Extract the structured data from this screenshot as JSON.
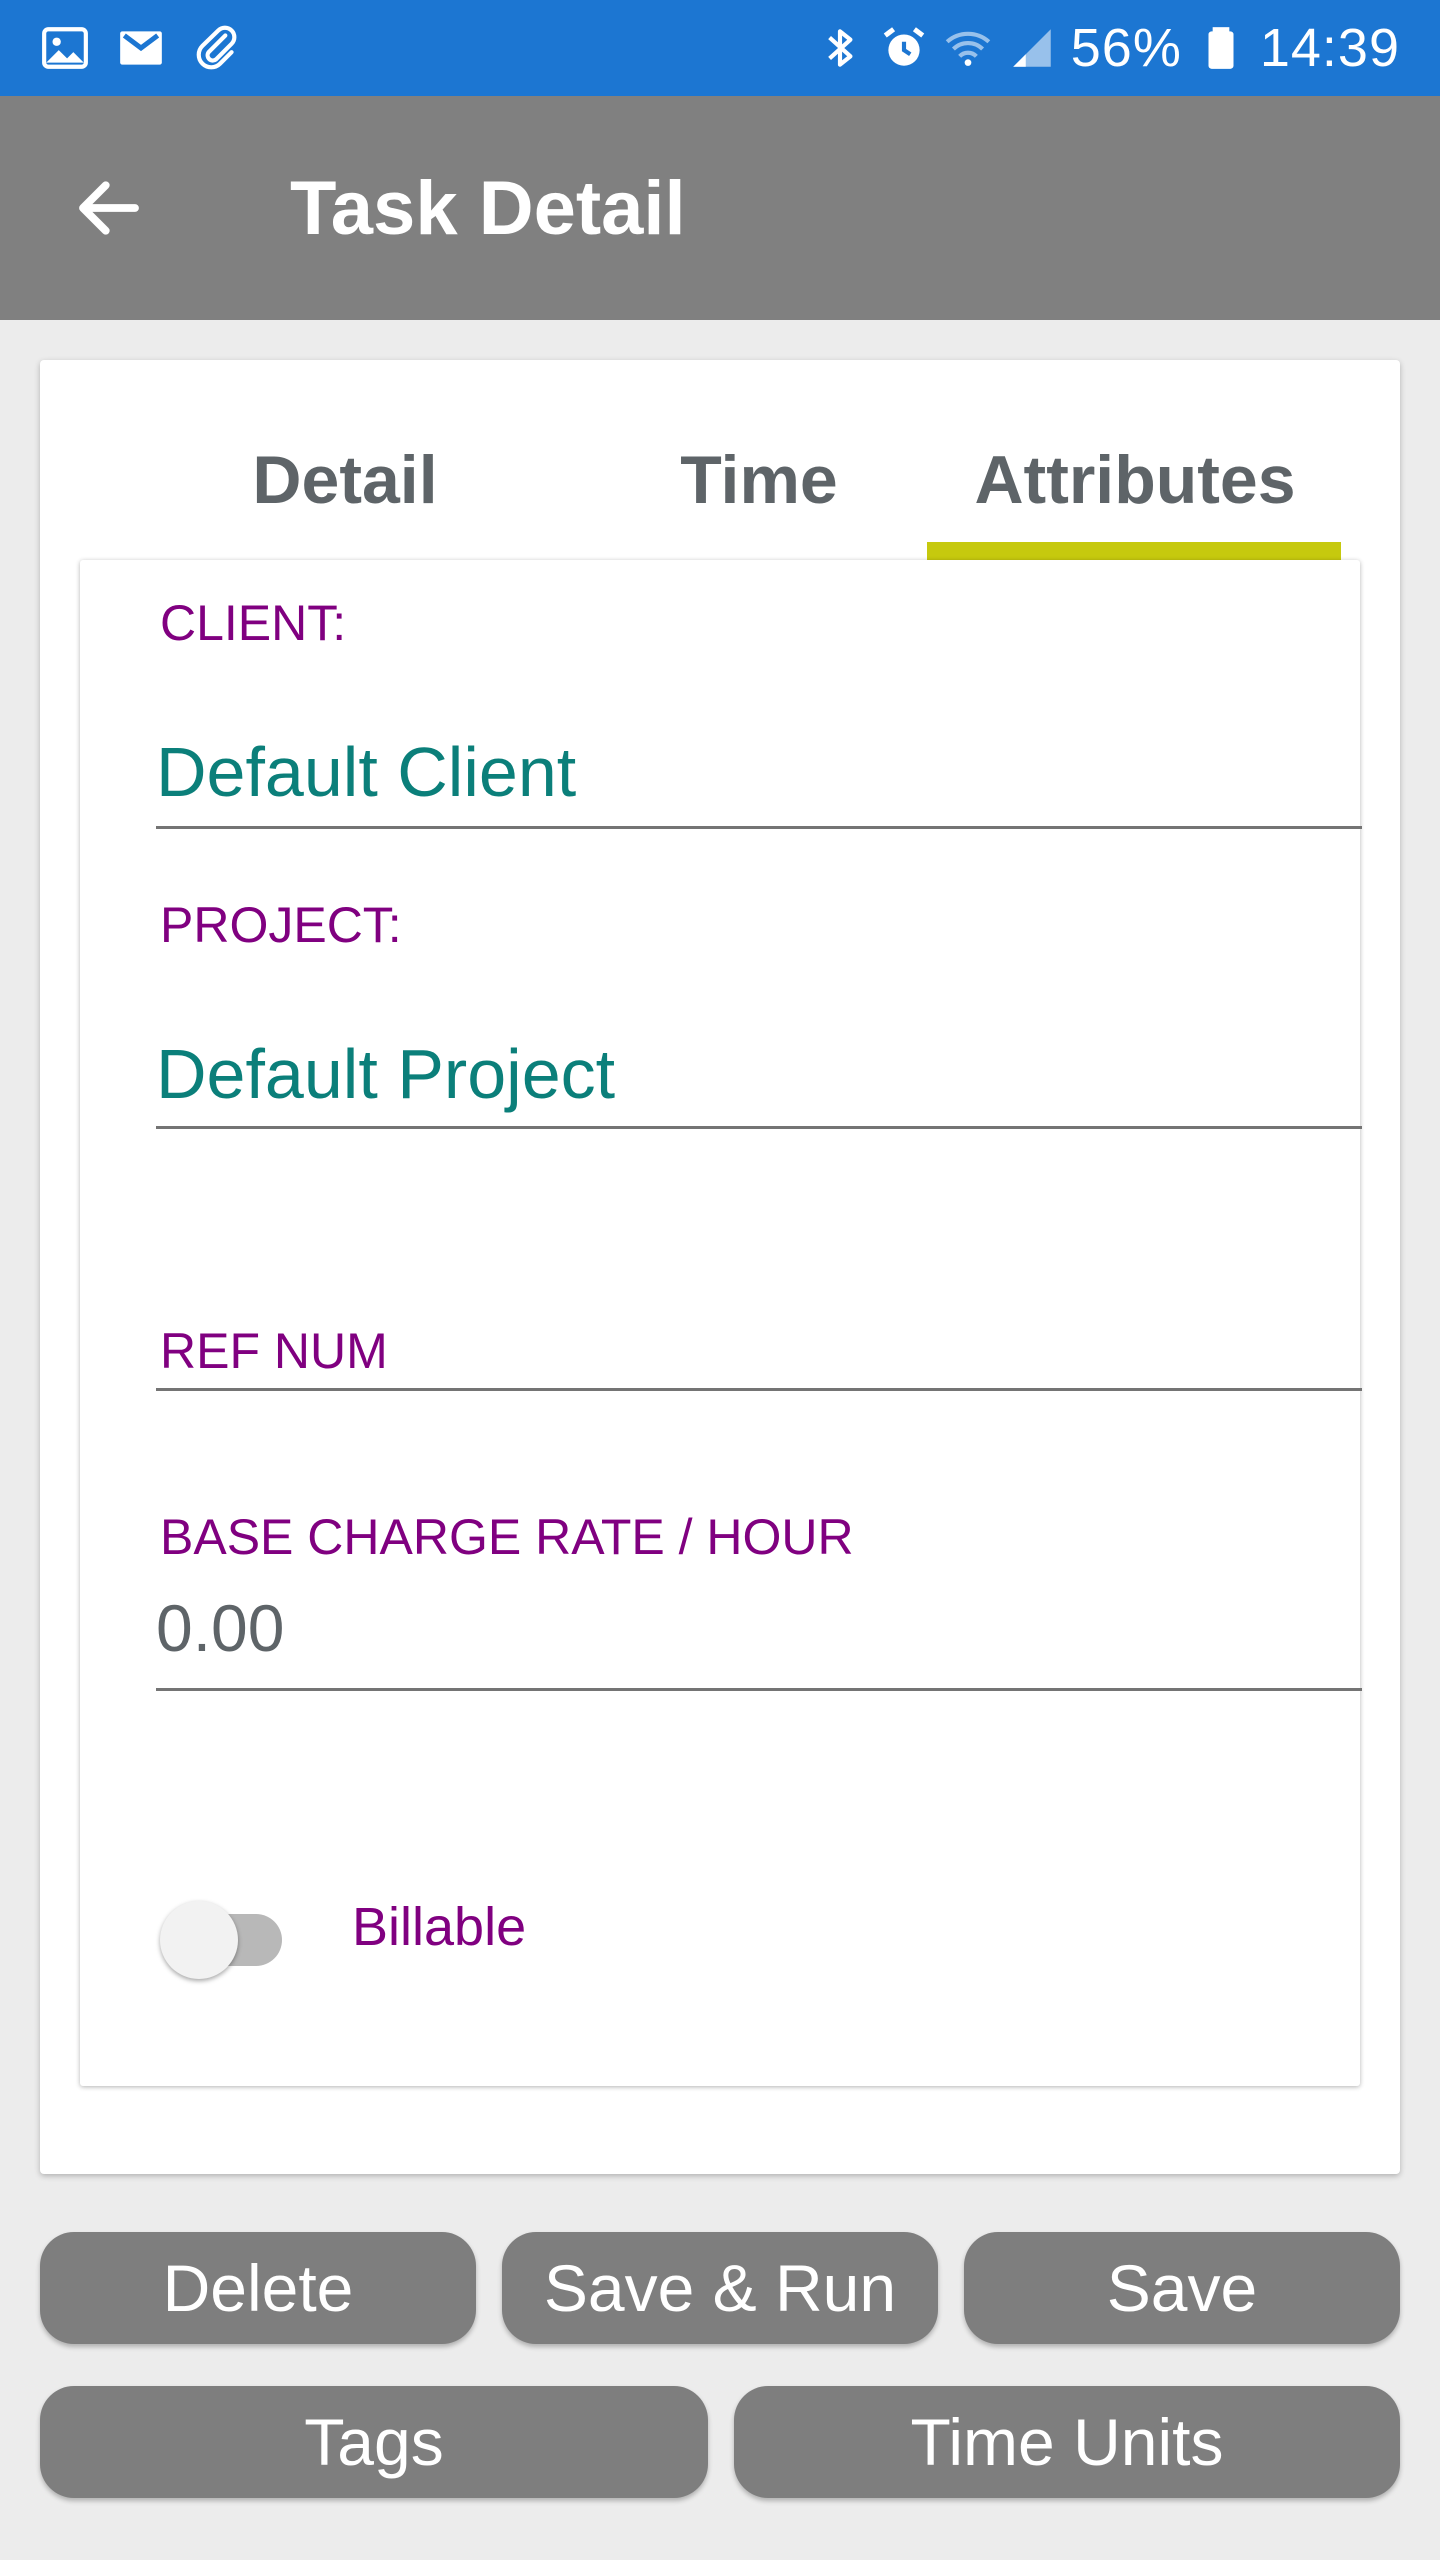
{
  "status_bar": {
    "icons_left": [
      "image-icon",
      "gmail-icon",
      "paperclip-icon"
    ],
    "icons_right": [
      "bluetooth-icon",
      "alarm-icon",
      "wifi-icon",
      "signal-icon",
      "battery-icon"
    ],
    "battery_percent": "56%",
    "time": "14:39"
  },
  "app_bar": {
    "title": "Task Detail",
    "back_icon": "arrow-left-icon"
  },
  "tabs": {
    "items": [
      {
        "label": "Detail"
      },
      {
        "label": "Time"
      },
      {
        "label": "Attributes"
      }
    ],
    "selected": "Attributes",
    "indicator_color": "#c6c90e"
  },
  "form": {
    "client_label": "CLIENT:",
    "client_value": "Default Client",
    "project_label": "PROJECT:",
    "project_value": "Default Project",
    "ref_num_label": "REF NUM",
    "rate_label": "BASE CHARGE RATE / HOUR",
    "rate_value": "0.00",
    "billable_label": "Billable",
    "billable_on": false
  },
  "buttons": {
    "delete": "Delete",
    "save_run": "Save & Run",
    "save": "Save",
    "tags": "Tags",
    "time_units": "Time Units"
  },
  "colors": {
    "status_bar": "#1c76d2",
    "app_bar": "#808080",
    "label": "#800080",
    "value": "#0b7f7a",
    "button": "#7e7e7e"
  }
}
